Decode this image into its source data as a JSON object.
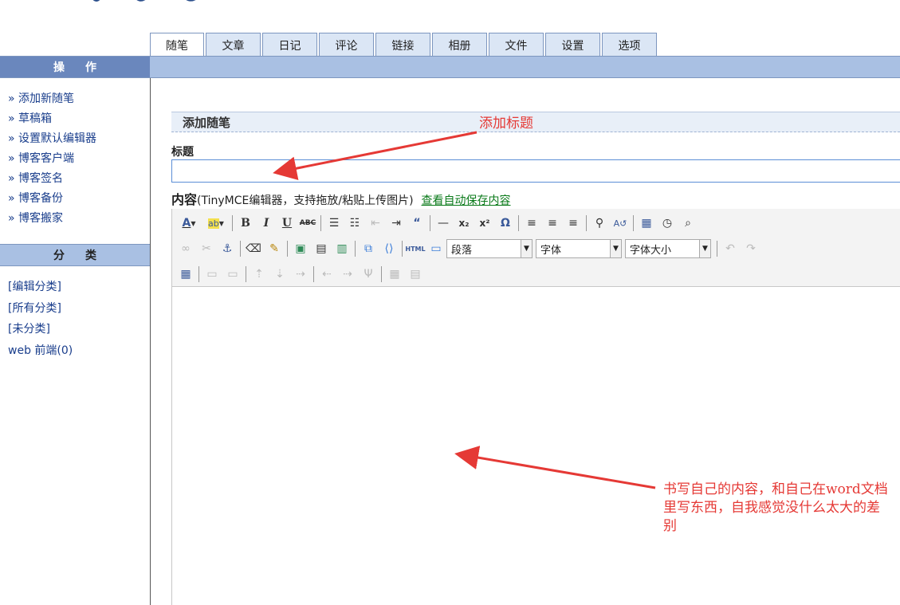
{
  "tabs": [
    {
      "label": "随笔",
      "active": true
    },
    {
      "label": "文章",
      "active": false
    },
    {
      "label": "日记",
      "active": false
    },
    {
      "label": "评论",
      "active": false
    },
    {
      "label": "链接",
      "active": false
    },
    {
      "label": "相册",
      "active": false
    },
    {
      "label": "文件",
      "active": false
    },
    {
      "label": "设置",
      "active": false
    },
    {
      "label": "选项",
      "active": false
    }
  ],
  "sidebar": {
    "ops_heading": "操作",
    "ops_links": [
      "» 添加新随笔",
      "» 草稿箱",
      "» 设置默认编辑器",
      "» 博客客户端",
      "» 博客签名",
      "» 博客备份",
      "» 博客搬家"
    ],
    "cat_heading": "分类",
    "cat_links": [
      "[编辑分类]",
      "[所有分类]",
      "[未分类]",
      "web 前端(0)"
    ]
  },
  "form": {
    "section_title": "添加随笔",
    "title_label": "标题",
    "title_value": "",
    "content_label_bold": "内容",
    "content_label_rest": "(TinyMCE编辑器，支持拖放/粘贴上传图片)",
    "autosave_link": "查看自动保存内容"
  },
  "editor": {
    "format_select": "段落",
    "font_select": "字体",
    "size_select": "字体大小"
  },
  "annotations": {
    "title_note": "添加标题",
    "content_note": "书写自己的内容，和自己在word文档里写东西，自我感觉没什么太大的差别"
  },
  "colors": {
    "accent_blue": "#a9c0e3",
    "header_dark": "#6a87bd",
    "link_blue": "#1a3e8c",
    "link_green": "#0a7a1a",
    "annotation_red": "#e53935"
  }
}
